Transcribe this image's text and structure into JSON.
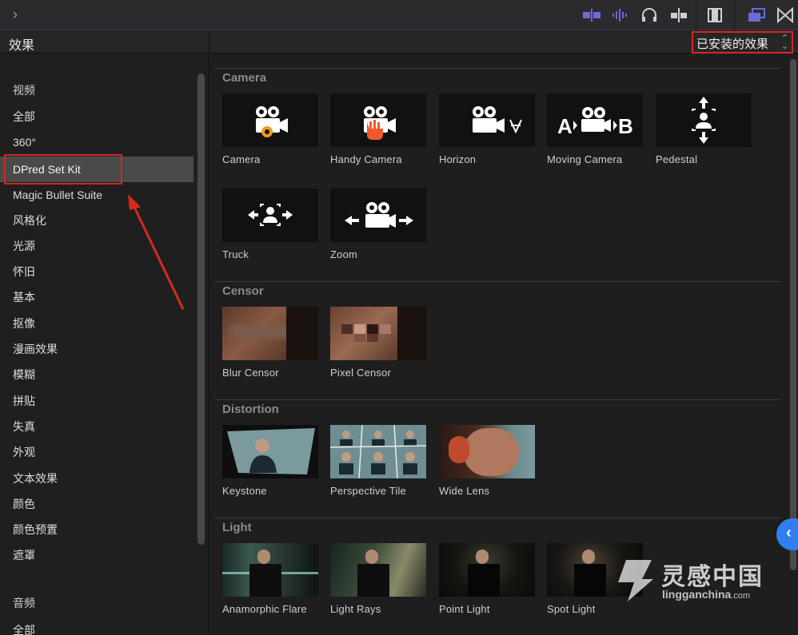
{
  "header": {
    "panel_title": "效果",
    "filter_value": "已安装的效果"
  },
  "sidebar": {
    "video_heading": "视频",
    "items": [
      {
        "label": "全部"
      },
      {
        "label": "360°"
      },
      {
        "label": "DPred Set Kit",
        "selected": true
      },
      {
        "label": "Magic Bullet Suite"
      },
      {
        "label": "风格化"
      },
      {
        "label": "光源"
      },
      {
        "label": "怀旧"
      },
      {
        "label": "基本"
      },
      {
        "label": "抠像"
      },
      {
        "label": "漫画效果"
      },
      {
        "label": "模糊"
      },
      {
        "label": "拼贴"
      },
      {
        "label": "失真"
      },
      {
        "label": "外观"
      },
      {
        "label": "文本效果"
      },
      {
        "label": "颜色"
      },
      {
        "label": "颜色预置"
      },
      {
        "label": "遮罩"
      }
    ],
    "audio_heading": "音频",
    "audio_items": [
      {
        "label": "全部"
      }
    ]
  },
  "sections": [
    {
      "title": "Camera",
      "effects": [
        {
          "label": "Camera",
          "icon": "camera-gear-icon"
        },
        {
          "label": "Handy Camera",
          "icon": "camera-hand-icon"
        },
        {
          "label": "Horizon",
          "icon": "camera-horizon-icon"
        },
        {
          "label": "Moving Camera",
          "icon": "camera-a-to-b-icon"
        },
        {
          "label": "Pedestal",
          "icon": "pedestal-icon"
        },
        {
          "label": "Truck",
          "icon": "truck-icon"
        },
        {
          "label": "Zoom",
          "icon": "camera-zoom-icon"
        }
      ]
    },
    {
      "title": "Censor",
      "effects": [
        {
          "label": "Blur Censor"
        },
        {
          "label": "Pixel Censor"
        }
      ]
    },
    {
      "title": "Distortion",
      "effects": [
        {
          "label": "Keystone"
        },
        {
          "label": "Perspective Tile"
        },
        {
          "label": "Wide Lens"
        }
      ]
    },
    {
      "title": "Light",
      "effects": [
        {
          "label": "Anamorphic Flare"
        },
        {
          "label": "Light Rays"
        },
        {
          "label": "Point Light"
        },
        {
          "label": "Spot Light"
        }
      ]
    }
  ],
  "watermark": {
    "brand": "灵感中国",
    "site": "lingganchina",
    "site_suffix": ".com"
  },
  "colors": {
    "annotation_red": "#d42a1e",
    "accent_blue": "#2f7ff0",
    "toolbar_purple": "#6a6ad8"
  }
}
